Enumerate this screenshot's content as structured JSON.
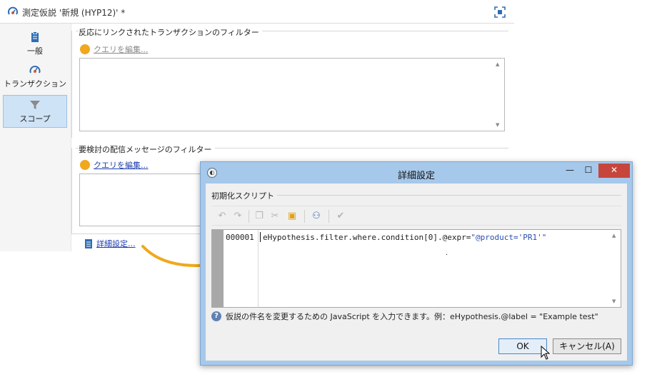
{
  "main_window": {
    "title": "測定仮説 '新規 (HYP12)' *",
    "sidebar": {
      "items": [
        {
          "label": "一般",
          "icon": "clipboard-icon"
        },
        {
          "label": "トランザクション",
          "icon": "gauge-icon"
        },
        {
          "label": "スコープ",
          "icon": "filter-icon",
          "selected": true
        }
      ]
    },
    "section1": {
      "title": "反応にリンクされたトランザクションのフィルター",
      "query_link": "クエリを編集..."
    },
    "section2": {
      "title": "要検討の配信メッセージのフィルター",
      "query_link": "クエリを編集..."
    },
    "advanced_link": "詳細設定..."
  },
  "dialog": {
    "title": "詳細設定",
    "section_label": "初期化スクリプト",
    "toolbar": [
      "undo-icon",
      "redo-icon",
      "copy-icon",
      "cut-icon",
      "paste-icon",
      "find-icon",
      "check-icon"
    ],
    "editor": {
      "line_number": "000001",
      "code_prefix": "eHypothesis.filter.where.condition[0].@expr=",
      "code_string": "\"@product='PR1'\""
    },
    "help_text": "仮説の件名を変更するための JavaScript を入力できます。例：eHypothesis.@label = \"Example test\"",
    "ok_label": "OK",
    "cancel_label": "キャンセル(A)",
    "window_buttons": {
      "minimize": "—",
      "maximize": "☐",
      "close": "✕"
    }
  },
  "colors": {
    "accent_orange": "#f0a81c",
    "link_blue": "#1f3fae",
    "dialog_frame": "#a6c8ea",
    "close_red": "#c7463c"
  }
}
